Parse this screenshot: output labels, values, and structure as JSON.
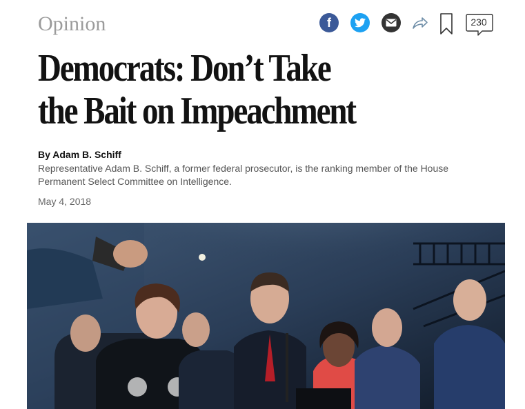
{
  "section": "Opinion",
  "share": {
    "facebook_icon": "facebook-icon",
    "twitter_icon": "twitter-icon",
    "email_icon": "email-icon",
    "share_icon": "share-arrow-icon",
    "save_icon": "bookmark-icon",
    "comments_icon": "comment-bubble-icon",
    "comment_count": "230"
  },
  "article": {
    "headline_line1": "Democrats: Don’t Take",
    "headline_line2": "the Bait on Impeachment",
    "byline": "By Adam B. Schiff",
    "bio": "Representative Adam B. Schiff, a former federal prosecutor, is the ranking member of the House Permanent Select Committee on Intelligence.",
    "date": "May 4, 2018"
  },
  "colors": {
    "facebook": "#3b5998",
    "twitter": "#1da1f2",
    "email": "#333333",
    "section_gray": "#9b9b9b",
    "headline": "#121212"
  }
}
